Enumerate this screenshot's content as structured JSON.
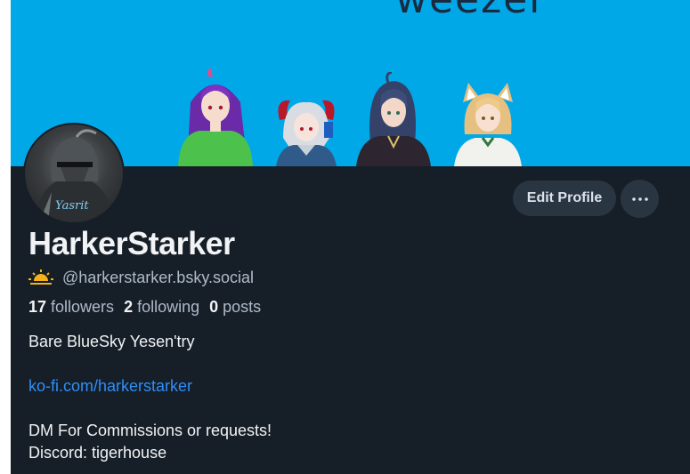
{
  "banner": {
    "text": "weezer"
  },
  "profile": {
    "display_name": "HarkerStarker",
    "handle": "@harkerstarker.bsky.social",
    "avatar_caption": "Yasrit"
  },
  "stats": {
    "followers_count": "17",
    "followers_label": "followers",
    "following_count": "2",
    "following_label": "following",
    "posts_count": "0",
    "posts_label": "posts"
  },
  "bio": {
    "line1": "Bare BlueSky Yesen'try",
    "link": "ko-fi.com/harkerstarker",
    "line3": "DM For Commissions or requests!",
    "line4": "Discord: tigerhouse"
  },
  "actions": {
    "edit_profile_label": "Edit Profile",
    "more_icon": "ellipsis-icon"
  },
  "colors": {
    "background": "#161e27",
    "banner": "#00a8e8",
    "button": "#2a3542",
    "link": "#2f8ef8",
    "text": "#f1f3f5",
    "muted": "#aebbc9"
  }
}
